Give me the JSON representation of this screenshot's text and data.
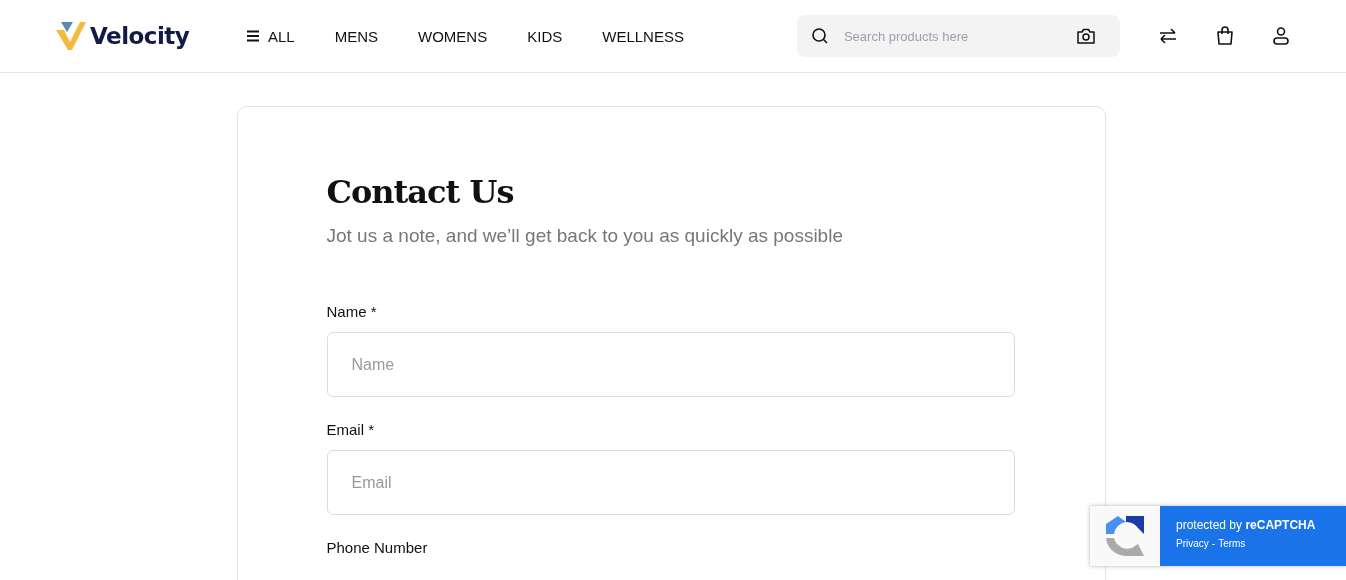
{
  "header": {
    "logo": "Velocity",
    "nav": [
      {
        "label": "ALL",
        "kind": "menu"
      },
      {
        "label": "MENS",
        "kind": "link"
      },
      {
        "label": "WOMENS",
        "kind": "link"
      },
      {
        "label": "KIDS",
        "kind": "link"
      },
      {
        "label": "WELLNESS",
        "kind": "link"
      }
    ],
    "search": {
      "placeholder": "Search products here"
    }
  },
  "contact": {
    "title": "Contact Us",
    "subtitle": "Jot us a note, and we’ll get back to you as quickly as possible",
    "fields": [
      {
        "label": "Name *",
        "placeholder": "Name"
      },
      {
        "label": "Email *",
        "placeholder": "Email"
      },
      {
        "label": "Phone Number"
      }
    ]
  },
  "recaptcha": {
    "text": "protected by **reCAPTCHA**",
    "links": [
      "Privacy",
      "-",
      "Terms"
    ]
  }
}
